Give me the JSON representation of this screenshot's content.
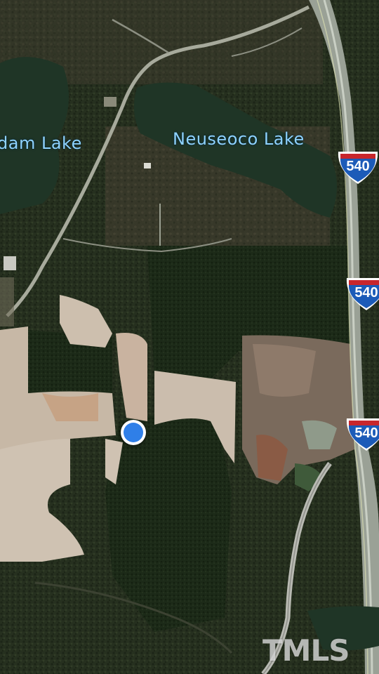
{
  "map": {
    "labels": {
      "lake_left": "dam Lake",
      "lake_right": "Neuseoco Lake"
    },
    "highway": {
      "route_number": "540",
      "shield_count": 3
    },
    "watermark": "TMLS",
    "colors": {
      "forest": "#24301c",
      "field": "#c9b9a8",
      "water": "#1f3526",
      "shield_blue": "#1c5bb8",
      "shield_red": "#c8262c",
      "location_blue": "#2f7fe8",
      "label_blue": "#8fd3ff"
    }
  }
}
